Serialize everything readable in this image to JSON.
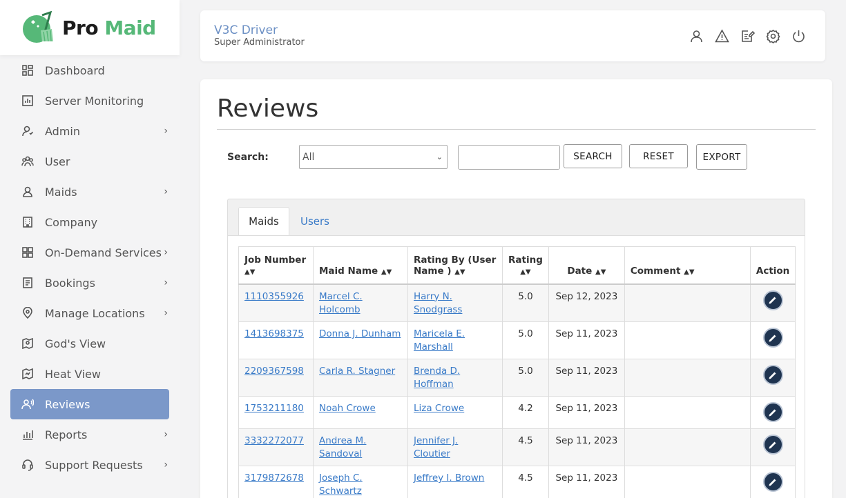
{
  "brand": {
    "name_part1": "Pro",
    "name_part2": "Maid",
    "accent": "#56b878"
  },
  "sidebar": {
    "items": [
      {
        "label": "Dashboard",
        "icon": "dashboard-icon",
        "chevron": false
      },
      {
        "label": "Server Monitoring",
        "icon": "server-monitoring-icon",
        "chevron": false
      },
      {
        "label": "Admin",
        "icon": "admin-icon",
        "chevron": true
      },
      {
        "label": "User",
        "icon": "users-icon",
        "chevron": false
      },
      {
        "label": "Maids",
        "icon": "maid-icon",
        "chevron": true
      },
      {
        "label": "Company",
        "icon": "building-icon",
        "chevron": false
      },
      {
        "label": "On-Demand Services",
        "icon": "services-icon",
        "chevron": true
      },
      {
        "label": "Bookings",
        "icon": "bookings-icon",
        "chevron": true
      },
      {
        "label": "Manage Locations",
        "icon": "location-pin-icon",
        "chevron": true
      },
      {
        "label": "God's View",
        "icon": "map-view-icon",
        "chevron": false
      },
      {
        "label": "Heat View",
        "icon": "heat-map-icon",
        "chevron": false
      },
      {
        "label": "Reviews",
        "icon": "reviews-icon",
        "chevron": false,
        "active": true
      },
      {
        "label": "Reports",
        "icon": "reports-icon",
        "chevron": true
      },
      {
        "label": "Support Requests",
        "icon": "support-icon",
        "chevron": true
      }
    ],
    "active_color": "#7b98c9"
  },
  "header": {
    "user_name": "V3C Driver",
    "user_role": "Super Administrator",
    "icons": [
      "profile-icon",
      "alert-icon",
      "notes-icon",
      "settings-icon",
      "power-icon"
    ]
  },
  "page": {
    "title": "Reviews",
    "search_label": "Search:",
    "select_value": "All",
    "search_placeholder": "",
    "search_button": "SEARCH",
    "reset_button": "RESET",
    "export_button": "EXPORT"
  },
  "tabs": [
    {
      "label": "Maids",
      "active": true
    },
    {
      "label": "Users",
      "active": false
    }
  ],
  "table": {
    "headers": [
      "Job Number",
      "Maid Name",
      "Rating By (User Name )",
      "Rating",
      "Date",
      "Comment",
      "Action"
    ],
    "rows": [
      {
        "job": "1110355926",
        "maid": "Marcel C. Holcomb",
        "by": "Harry N. Snodgrass",
        "rating": "5.0",
        "date": "Sep 12, 2023",
        "comment": ""
      },
      {
        "job": "1413698375",
        "maid": "Donna J. Dunham",
        "by": "Maricela E. Marshall",
        "rating": "5.0",
        "date": "Sep 11, 2023",
        "comment": ""
      },
      {
        "job": "2209367598",
        "maid": "Carla R. Stagner",
        "by": "Brenda D. Hoffman",
        "rating": "5.0",
        "date": "Sep 11, 2023",
        "comment": ""
      },
      {
        "job": "1753211180",
        "maid": "Noah Crowe",
        "by": "Liza Crowe",
        "rating": "4.2",
        "date": "Sep 11, 2023",
        "comment": ""
      },
      {
        "job": "3332272077",
        "maid": "Andrea M. Sandoval",
        "by": "Jennifer J. Cloutier",
        "rating": "4.5",
        "date": "Sep 11, 2023",
        "comment": ""
      },
      {
        "job": "3179872678",
        "maid": "Joseph C. Schwartz",
        "by": "Jeffrey I. Brown",
        "rating": "4.5",
        "date": "Sep 11, 2023",
        "comment": ""
      }
    ]
  }
}
